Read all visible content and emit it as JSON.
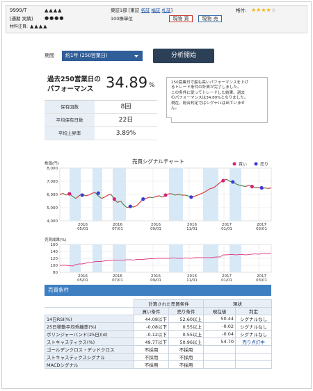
{
  "header": {
    "code": "9999/T",
    "marks1": "▲▲▲▲",
    "market": "東証1部",
    "market_sub_open": "[",
    "market_sub_label": "東証",
    "market_links": [
      "名証",
      "福証",
      "札証"
    ],
    "market_sub_close": "]",
    "rating_label": "格付:",
    "rating_stars": 4,
    "rating_max": 5,
    "row2_label": "[通期 実績]",
    "row2_marks": "●●●●",
    "unit": "100株単位",
    "buy_button": "現物 買",
    "sell_button": "現物 売",
    "row3_label": "材料注目:",
    "row3_marks": "▲▲▲▲",
    "colors": {
      "stars": "#f1b30c",
      "buy_border": "#cc3333",
      "sell_border": "#3366aa"
    }
  },
  "controls": {
    "period_label": "期間",
    "period_value": "約1年 (250営業日)",
    "run_button": "分析開始"
  },
  "performance": {
    "title_line1": "過去250営業日の",
    "title_line2": "パフォーマンス",
    "value": "34.89",
    "unit": "%",
    "rows": [
      {
        "label": "保有回数",
        "value": "8回"
      },
      {
        "label": "平均保有日数",
        "value": "22日"
      },
      {
        "label": "平均上昇率",
        "value": "3.89%"
      }
    ]
  },
  "note": {
    "lines": [
      "250営業日で最も高いパフォーマンスを上げ",
      "るトレード条件の計算が完了しました。",
      "この条件に従ってトレードした結果、過去",
      "のパフォーマンスは34.89%となりました。",
      "現在、総合判定ではシグナルは出ていませ",
      "ん。"
    ]
  },
  "chart_title": "売買シグナルチャート",
  "chart_data": [
    {
      "type": "line",
      "ylabel": "株価(円)",
      "ylim": [
        4000,
        8000
      ],
      "yticks": [
        "8,000",
        "7,000",
        "6,000",
        "5,000",
        "4,000"
      ],
      "legend": [
        {
          "name": "買い",
          "color": "#d6247a"
        },
        {
          "name": "売り",
          "color": "#3a3ad6"
        }
      ],
      "x_ticks": [
        {
          "top": "2016",
          "bottom": "05/01"
        },
        {
          "top": "2016",
          "bottom": "07/01"
        },
        {
          "top": "2016",
          "bottom": "09/01"
        },
        {
          "top": "2016",
          "bottom": "11/01"
        },
        {
          "top": "2017",
          "bottom": "01/01"
        },
        {
          "top": "2017",
          "bottom": "03/01"
        }
      ],
      "series": [
        {
          "values": [
            6000,
            6080,
            5950,
            6050,
            5850,
            5700,
            5900,
            6050,
            5900,
            5950,
            6080,
            6150,
            5900,
            5700,
            5800,
            5950,
            6000,
            5650,
            5400,
            5500,
            5200,
            5000,
            5100,
            5050,
            5150,
            5400,
            5650,
            5700,
            5800,
            5750,
            5850,
            5900,
            5800,
            5950,
            6050,
            6050,
            5950,
            6000,
            5950,
            5950,
            5900,
            5800,
            5850,
            5950,
            6050,
            6150,
            6300,
            6450,
            6500,
            6700,
            6900,
            7050,
            7150,
            7000,
            6950,
            6800,
            6700,
            6650,
            6600,
            6700,
            6600,
            6500,
            6550,
            6450,
            6500,
            6450,
            6500
          ]
        }
      ],
      "buy_signals": [
        [
          3,
          6050
        ],
        [
          17,
          5650
        ],
        [
          33,
          5950
        ],
        [
          51,
          7050
        ],
        [
          60,
          6600
        ]
      ],
      "sell_signals": [
        [
          7,
          5950
        ],
        [
          12,
          6100
        ],
        [
          22,
          5100
        ],
        [
          26,
          5650
        ],
        [
          41,
          5800
        ],
        [
          54,
          6950
        ],
        [
          63,
          6500
        ]
      ]
    },
    {
      "type": "line",
      "ylabel": "売買成果(%)",
      "ylim": [
        80,
        160
      ],
      "yticks": [
        "160",
        "140",
        "120",
        "100",
        "80"
      ],
      "x_ticks": [
        {
          "top": "2016",
          "bottom": "05/01"
        },
        {
          "top": "2016",
          "bottom": "07/01"
        },
        {
          "top": "2016",
          "bottom": "09/01"
        },
        {
          "top": "2016",
          "bottom": "11/01"
        },
        {
          "top": "2017",
          "bottom": "01/01"
        },
        {
          "top": "2017",
          "bottom": "03/01"
        }
      ],
      "series": [
        {
          "values": [
            100,
            100,
            100,
            99,
            98,
            102,
            104,
            104,
            106,
            108,
            108,
            111,
            111,
            111,
            113,
            113,
            114,
            115,
            115,
            115,
            115,
            116,
            116,
            115,
            117,
            117,
            117,
            118,
            119,
            119,
            120,
            120,
            120,
            120,
            120,
            121,
            121,
            120,
            120,
            121,
            121,
            120,
            122,
            122,
            122,
            122,
            122,
            122,
            123,
            124,
            124,
            130,
            130,
            131,
            131,
            130,
            131,
            131,
            130,
            131,
            132,
            133,
            132,
            133,
            134,
            133,
            134
          ]
        }
      ]
    }
  ],
  "conditions": {
    "section_title": "売買条件",
    "group_headers": [
      "計算された売買条件",
      "現状"
    ],
    "col_headers": [
      "買い条件",
      "売り条件",
      "現在値",
      "判定"
    ],
    "rows": [
      {
        "name": "14日RSI(%)",
        "buy": "44.08以下",
        "sell": "52.60以上",
        "current": "50.44",
        "judge": "シグナルなし"
      },
      {
        "name": "25日移動平均乖離率(%)",
        "buy": "-0.08以下",
        "sell": "0.55以上",
        "current": "-0.02",
        "judge": "シグナルなし"
      },
      {
        "name": "ボリンジャーバンド(25日)(σ)",
        "buy": "-0.12以下",
        "sell": "0.55以上",
        "current": "-0.04",
        "judge": "シグナルなし"
      },
      {
        "name": "ストキャスティクス(%)",
        "buy": "49.77以下",
        "sell": "50.96以上",
        "current": "54.70",
        "judge": "売り点灯中"
      },
      {
        "name": "ゴールデンクロス・デッドクロス",
        "buy": "不採用",
        "sell": "不採用",
        "current": "",
        "judge": ""
      },
      {
        "name": "ストキャスティクスシグナル",
        "buy": "不採用",
        "sell": "不採用",
        "current": "",
        "judge": ""
      },
      {
        "name": "MACDシグナル",
        "buy": "不採用",
        "sell": "不採用",
        "current": "",
        "judge": ""
      }
    ]
  }
}
